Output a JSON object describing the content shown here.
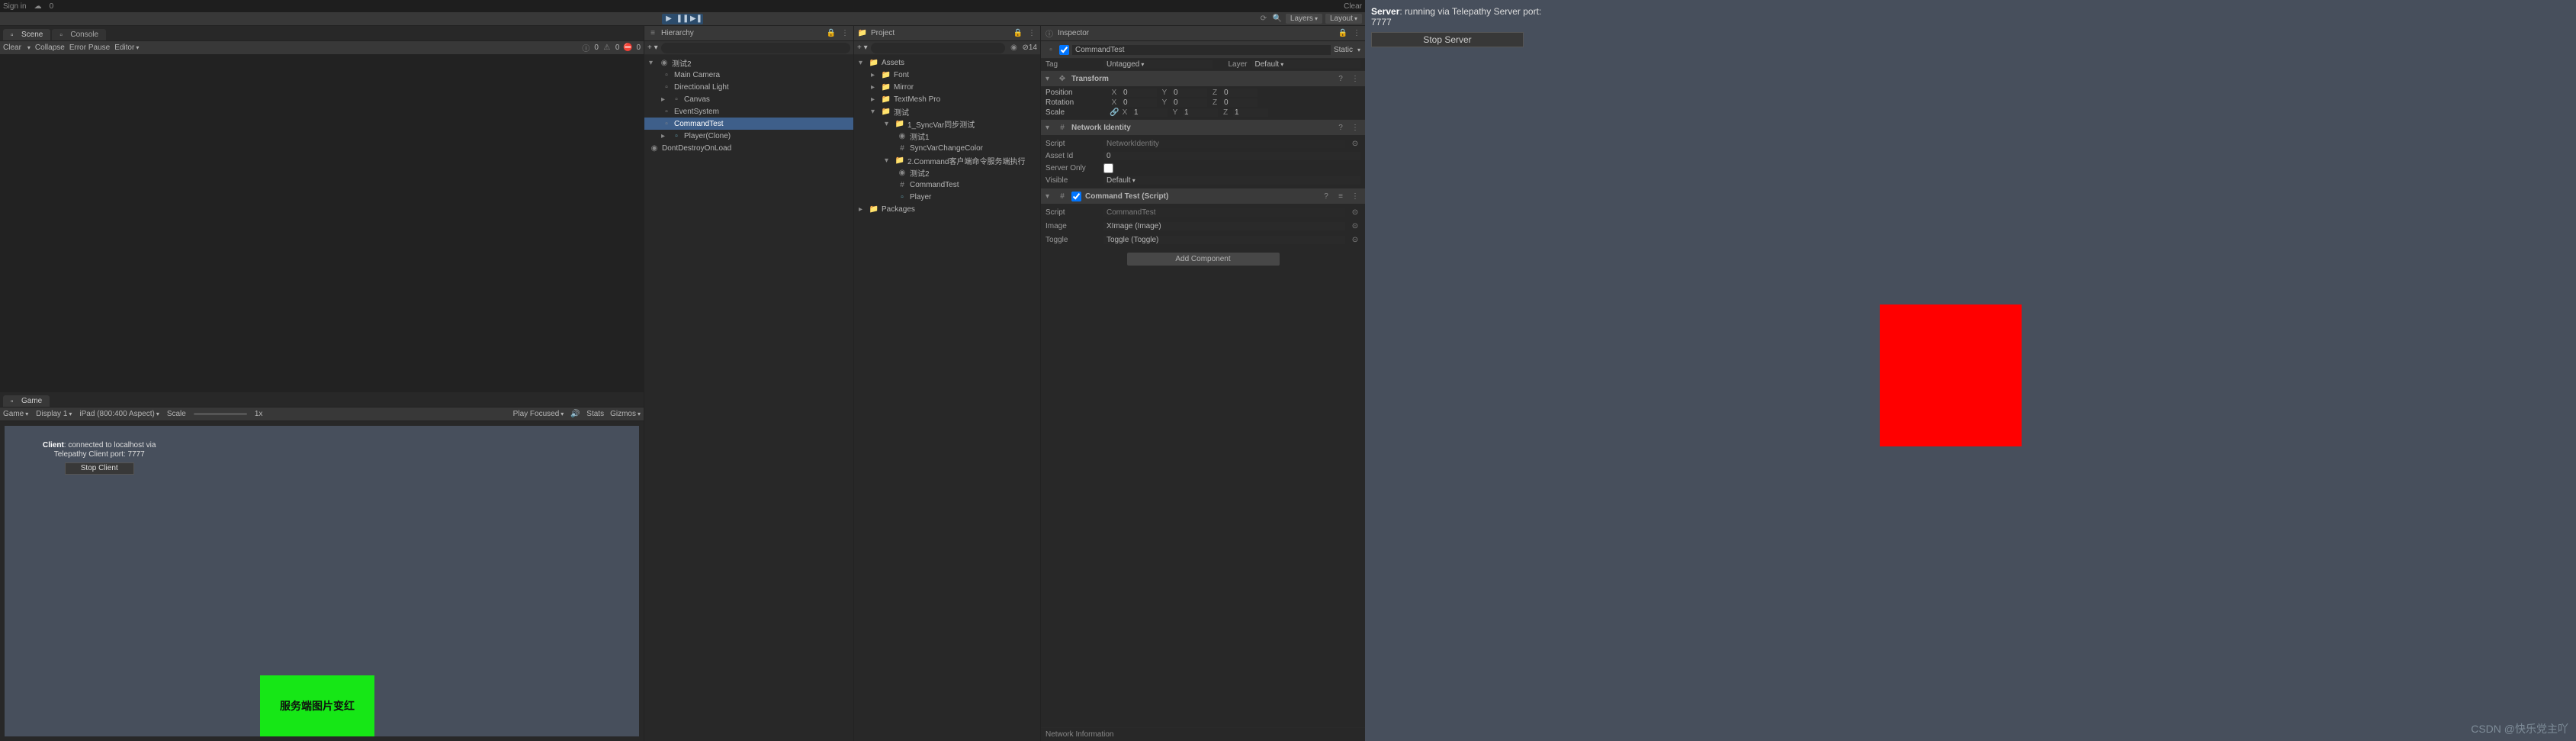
{
  "topbar": {
    "signin": "Sign in",
    "status": "0",
    "clear": "Clear"
  },
  "toolbar": {
    "layers": "Layers",
    "layout": "Layout"
  },
  "scene": {
    "tab_scene": "Scene",
    "tab_console": "Console",
    "sub_clear": "Clear",
    "sub_collapse": "Collapse",
    "sub_errpause": "Error Pause",
    "sub_editor": "Editor",
    "count0": "0",
    "count1": "0",
    "count2": "0"
  },
  "game": {
    "tab": "Game",
    "game": "Game",
    "display": "Display 1",
    "aspect": "iPad (800:400 Aspect)",
    "scale": "Scale",
    "scaleval": "1x",
    "playfocused": "Play Focused",
    "stats": "Stats",
    "gizmos": "Gizmos",
    "hud1a": "Client",
    "hud1b": ": connected to localhost via",
    "hud2": "Telepathy Client port: 7777",
    "stop": "Stop Client",
    "greenbtn": "服务端图片变红"
  },
  "hierarchy": {
    "title": "Hierarchy",
    "scene_name": "测试2",
    "items": [
      "Main Camera",
      "Directional Light",
      "Canvas",
      "EventSystem",
      "CommandTest",
      "Player(Clone)",
      "DontDestroyOnLoad"
    ]
  },
  "project": {
    "title": "Project",
    "assets": "Assets",
    "items": [
      "Font",
      "Mirror",
      "TextMesh Pro"
    ],
    "test": "测试",
    "t1": "1_SyncVar同步测试",
    "t1a": "测试1",
    "t1b": "SyncVarChangeColor",
    "t2": "2.Command客户端命令服务端执行",
    "t2a": "测试2",
    "t2b": "CommandTest",
    "t2c": "Player",
    "packages": "Packages",
    "counts": "14"
  },
  "inspector": {
    "title": "Inspector",
    "name": "CommandTest",
    "static": "Static",
    "tag": "Tag",
    "tagval": "Untagged",
    "layer": "Layer",
    "layerval": "Default",
    "transform": "Transform",
    "pos": "Position",
    "rot": "Rotation",
    "scl": "Scale",
    "px": "0",
    "py": "0",
    "pz": "0",
    "rx": "0",
    "ry": "0",
    "rz": "0",
    "sx": "1",
    "sy": "1",
    "sz": "1",
    "netid": "Network Identity",
    "ni_script": "Script",
    "ni_scriptval": "NetworkIdentity",
    "ni_asset": "Asset Id",
    "ni_assetval": "0",
    "ni_server": "Server Only",
    "ni_vis": "Visible",
    "ni_visval": "Default",
    "cmdtest": "Command Test (Script)",
    "ct_script": "Script",
    "ct_scriptval": "CommandTest",
    "ct_image": "Image",
    "ct_imageval": "XImage (Image)",
    "ct_toggle": "Toggle",
    "ct_toggleval": "Toggle (Toggle)",
    "addcomp": "Add Component",
    "netinfo": "Network Information"
  },
  "server": {
    "line1a": "Server",
    "line1b": ": running via Telepathy Server port:",
    "line2": "7777",
    "stop": "Stop Server"
  },
  "watermark": "CSDN @快乐党主吖"
}
